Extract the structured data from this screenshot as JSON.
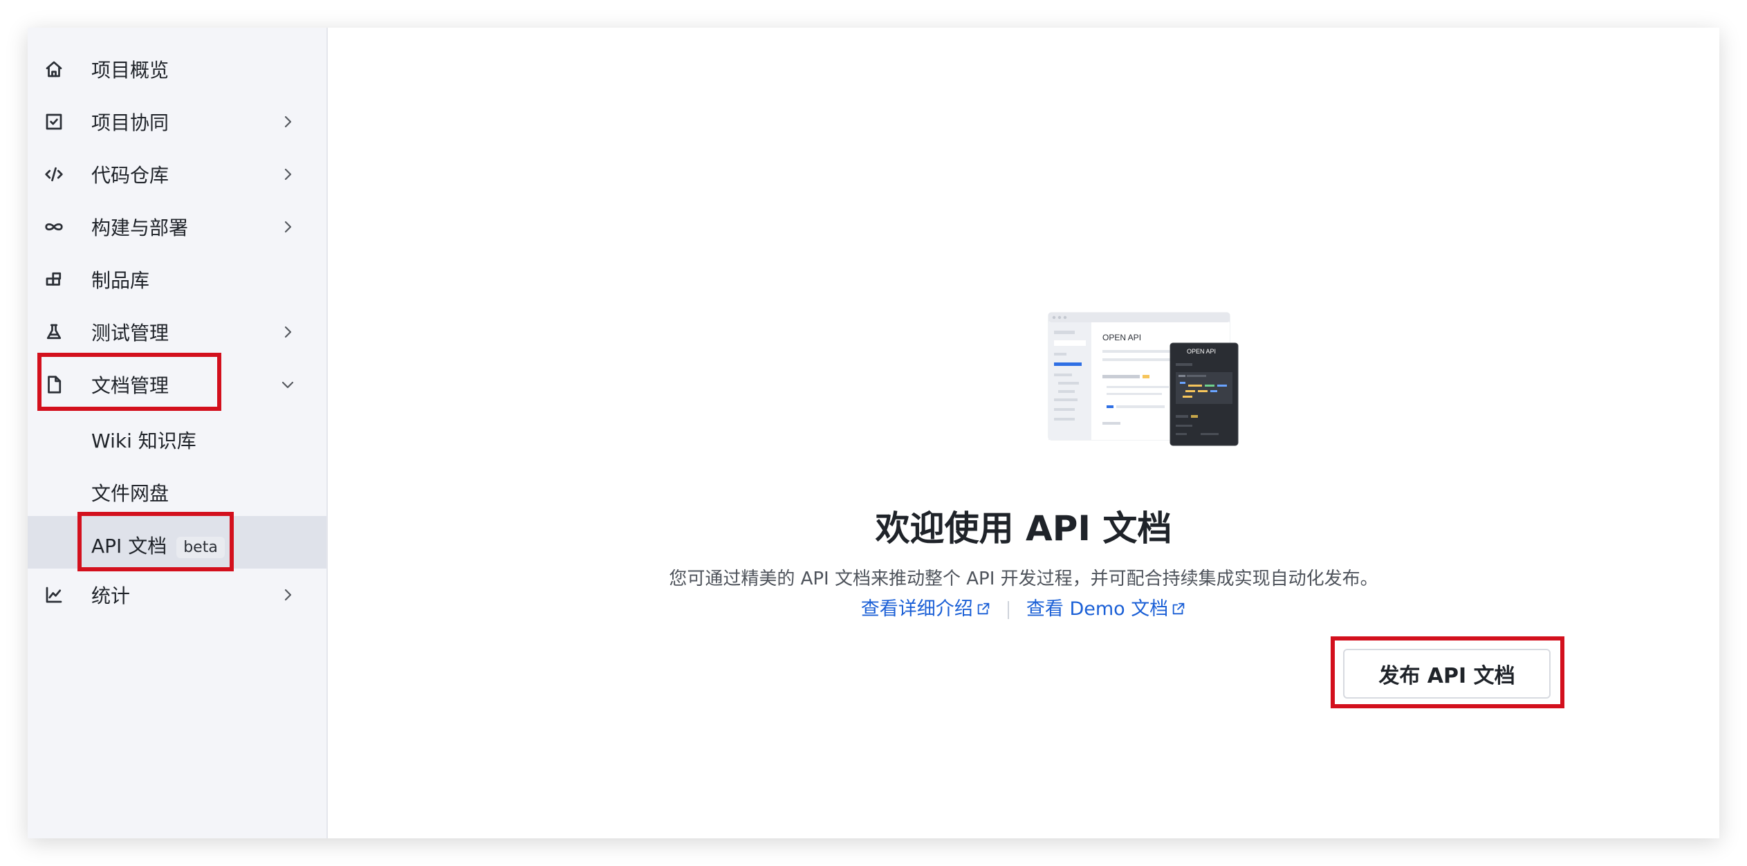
{
  "sidebar": {
    "items": [
      {
        "label": "项目概览",
        "icon": "home-icon",
        "expandable": false
      },
      {
        "label": "项目协同",
        "icon": "checkbox-icon",
        "expandable": true
      },
      {
        "label": "代码仓库",
        "icon": "code-icon",
        "expandable": true
      },
      {
        "label": "构建与部署",
        "icon": "infinity-icon",
        "expandable": true
      },
      {
        "label": "制品库",
        "icon": "artifact-icon",
        "expandable": false
      },
      {
        "label": "测试管理",
        "icon": "flask-icon",
        "expandable": true
      },
      {
        "label": "文档管理",
        "icon": "document-icon",
        "expandable": true,
        "expanded": true
      },
      {
        "label": "统计",
        "icon": "chart-icon",
        "expandable": true
      }
    ],
    "doc_subitems": [
      {
        "label": "Wiki 知识库"
      },
      {
        "label": "文件网盘"
      },
      {
        "label": "API 文档",
        "badge": "beta",
        "active": true
      }
    ]
  },
  "main": {
    "illustration": {
      "card_title": "OPEN API",
      "dark_card_title": "OPEN API"
    },
    "title": "欢迎使用 API 文档",
    "description": "您可通过精美的 API 文档来推动整个 API 开发过程，并可配合持续集成实现自动化发布。",
    "link_intro": "查看详细介绍",
    "link_demo": "查看 Demo 文档",
    "publish_button": "发布 API 文档"
  },
  "colors": {
    "accent_link": "#1a5fd6",
    "highlight": "#d3101d",
    "sidebar_bg": "#f4f5f9",
    "active_bg": "#dfe2ea"
  }
}
